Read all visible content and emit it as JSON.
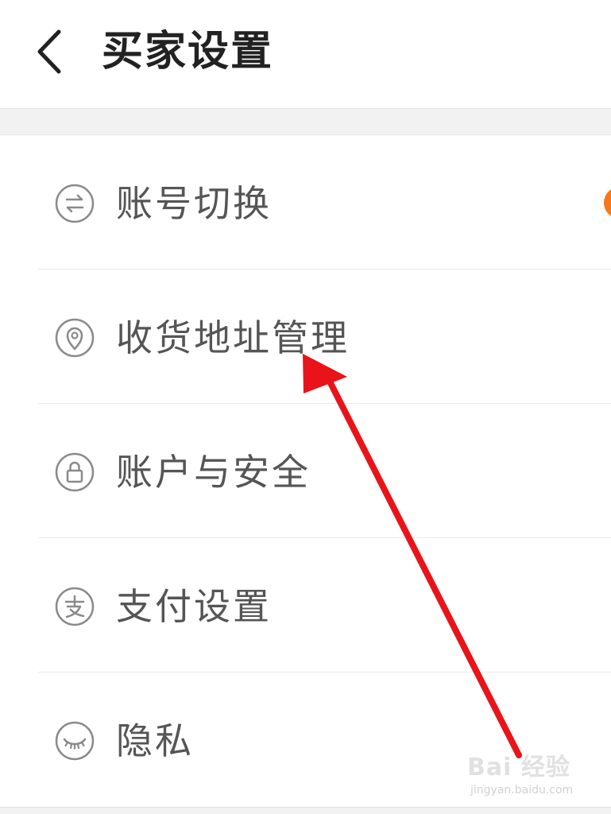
{
  "header": {
    "back_icon": "chevron-left-icon",
    "title": "买家设置"
  },
  "settings": {
    "items": [
      {
        "label": "账号切换",
        "icon": "switch-account-icon",
        "has_badge": true
      },
      {
        "label": "收货地址管理",
        "icon": "location-pin-icon"
      },
      {
        "label": "账户与安全",
        "icon": "lock-icon"
      },
      {
        "label": "支付设置",
        "icon": "payment-icon"
      },
      {
        "label": "隐私",
        "icon": "eye-closed-icon"
      }
    ]
  },
  "colors": {
    "badge": "#f7781a",
    "arrow": "#e8141a",
    "label_text": "#555555",
    "title_text": "#222222"
  },
  "watermark": {
    "text": "Bai 经验",
    "sub": "jingyan.baidu.com"
  }
}
